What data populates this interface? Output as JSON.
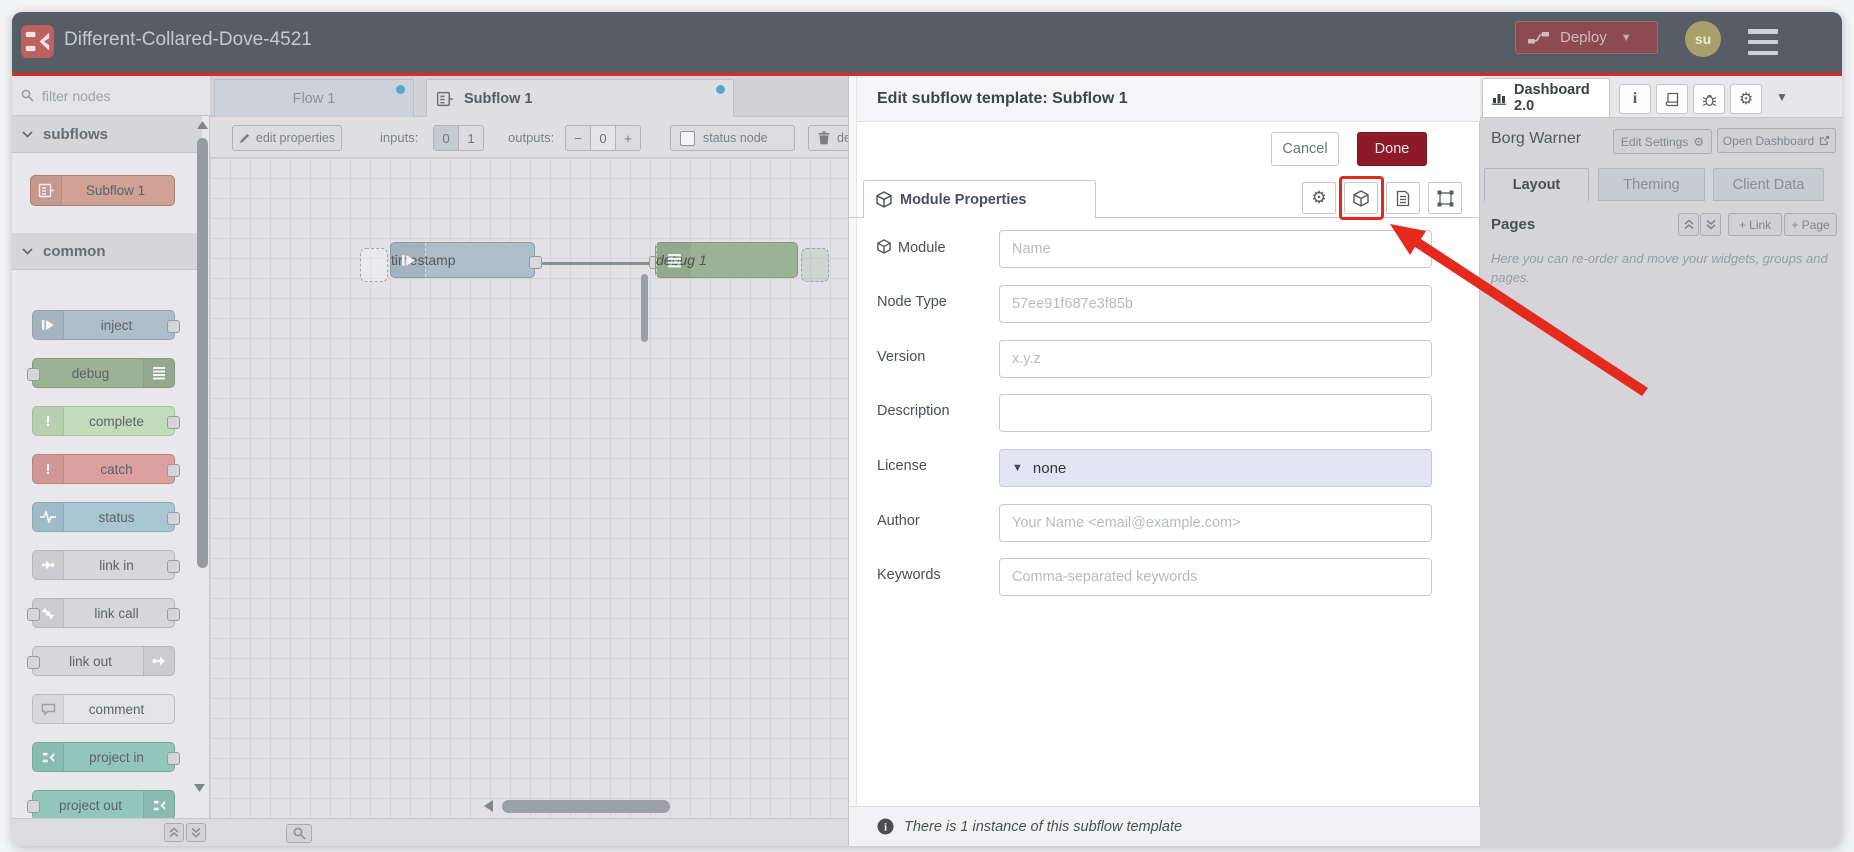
{
  "header": {
    "title": "Different-Collared-Dove-4521",
    "deploy": "Deploy",
    "avatar": "su"
  },
  "palette": {
    "filter_placeholder": "filter nodes",
    "categories": [
      {
        "label": "subflows",
        "nodes": [
          {
            "label": "Subflow 1"
          }
        ]
      },
      {
        "label": "common",
        "nodes": [
          {
            "label": "inject"
          },
          {
            "label": "debug"
          },
          {
            "label": "complete"
          },
          {
            "label": "catch"
          },
          {
            "label": "status"
          },
          {
            "label": "link in"
          },
          {
            "label": "link call"
          },
          {
            "label": "link out"
          },
          {
            "label": "comment"
          },
          {
            "label": "project in"
          },
          {
            "label": "project out"
          }
        ]
      }
    ]
  },
  "workspace": {
    "tabs": [
      {
        "label": "Flow 1"
      },
      {
        "label": "Subflow 1"
      }
    ],
    "toolbar": {
      "edit_properties": "edit properties",
      "inputs_label": "inputs:",
      "input_zero": "0",
      "input_one": "1",
      "outputs_label": "outputs:",
      "minus": "−",
      "outputs_value": "0",
      "plus": "+",
      "status_node": "status node",
      "delete_subflow": "delete subflow"
    },
    "canvas": {
      "nodes": [
        {
          "label": "timestamp"
        },
        {
          "label": "debug 1"
        }
      ]
    }
  },
  "tray": {
    "title": "Edit subflow template: Subflow 1",
    "cancel": "Cancel",
    "done": "Done",
    "tab": "Module Properties",
    "fields": [
      {
        "label": "Module",
        "placeholder": "Name"
      },
      {
        "label": "Node Type",
        "placeholder": "57ee91f687e3f85b"
      },
      {
        "label": "Version",
        "placeholder": "x.y.z"
      },
      {
        "label": "Description",
        "placeholder": ""
      },
      {
        "label": "License",
        "value": "none"
      },
      {
        "label": "Author",
        "placeholder": "Your Name <email@example.com>"
      },
      {
        "label": "Keywords",
        "placeholder": "Comma-separated keywords"
      }
    ],
    "footer": "There is 1 instance of this subflow template"
  },
  "sidebar": {
    "tab": "Dashboard 2.0",
    "project": "Borg Warner",
    "edit_settings": "Edit Settings",
    "open_dashboard": "Open Dashboard",
    "tabs": [
      {
        "label": "Layout"
      },
      {
        "label": "Theming"
      },
      {
        "label": "Client Data"
      }
    ],
    "pages": {
      "title": "Pages",
      "link": "+ Link",
      "page": "+ Page"
    },
    "hint": "Here you can re-order and move your widgets, groups and pages."
  }
}
